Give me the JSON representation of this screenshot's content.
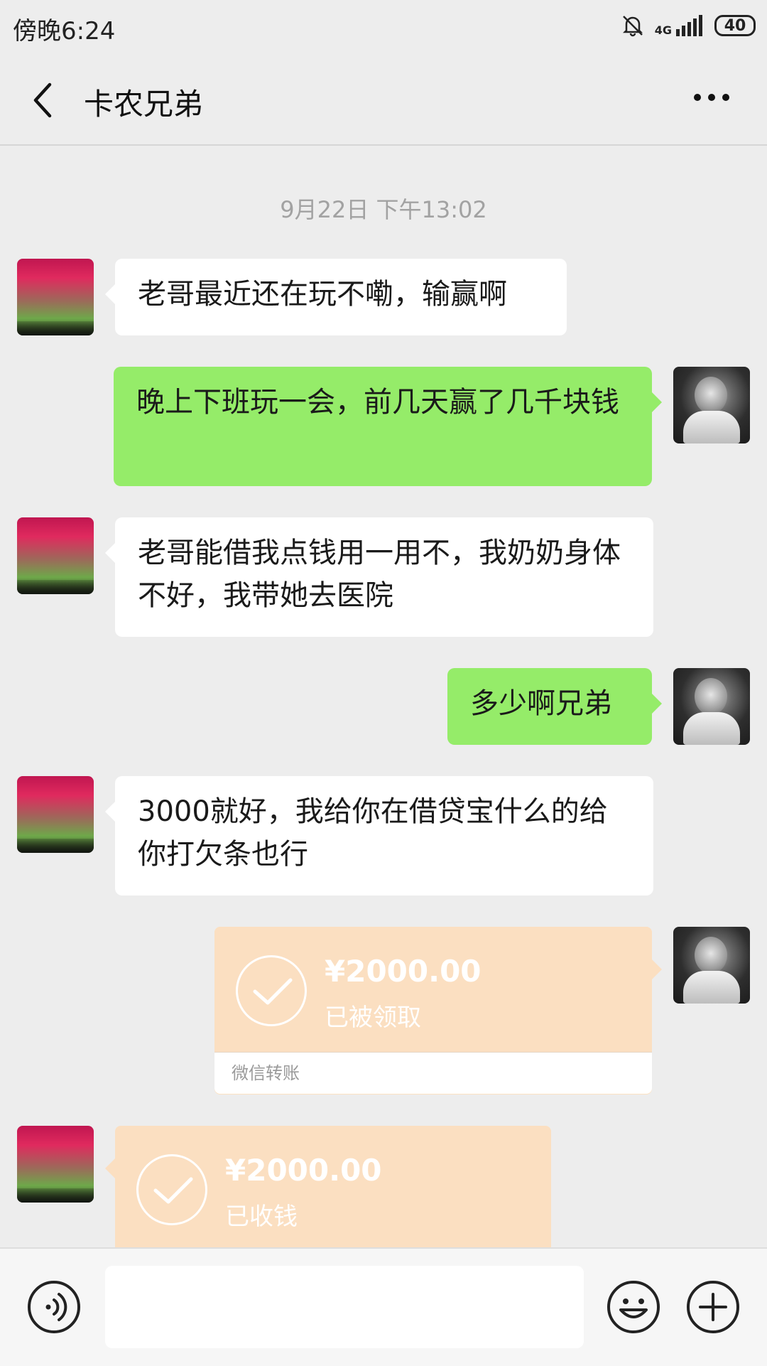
{
  "status_bar": {
    "time": "傍晚6:24",
    "network": "4G",
    "battery": "40"
  },
  "header": {
    "title": "卡农兄弟"
  },
  "chat": {
    "timestamp": "9月22日 下午13:02",
    "messages": [
      {
        "side": "left",
        "text": "老哥最近还在玩不嘞，输赢啊"
      },
      {
        "side": "right",
        "text": "晚上下班玩一会，前几天赢了几千块钱"
      },
      {
        "side": "left",
        "text": "老哥能借我点钱用一用不，我奶奶身体不好，我带她去医院"
      },
      {
        "side": "right",
        "text": "多少啊兄弟"
      },
      {
        "side": "left",
        "text": "3000就好，我给你在借贷宝什么的给你打欠条也行"
      }
    ],
    "transfers": [
      {
        "side": "right",
        "amount": "¥2000.00",
        "status": "已被领取",
        "footer": "微信转账"
      },
      {
        "side": "left",
        "amount": "¥2000.00",
        "status": "已收钱"
      }
    ]
  },
  "input_bar": {
    "value": "",
    "placeholder": ""
  },
  "colors": {
    "background": "#ededed",
    "sent_bubble": "#95ec69",
    "received_bubble": "#ffffff",
    "transfer_card": "#fbdfc1"
  }
}
